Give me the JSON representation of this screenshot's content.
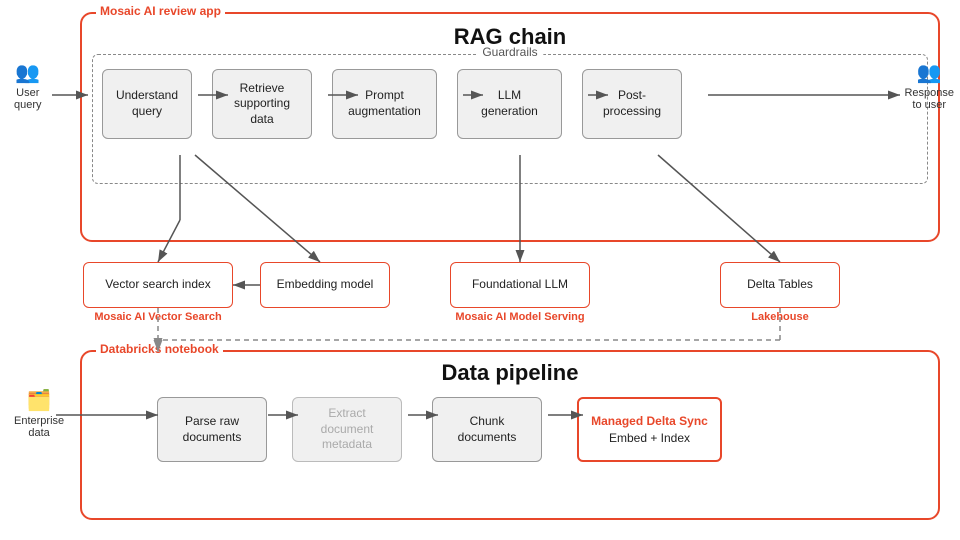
{
  "rag": {
    "outer_label": "Mosaic AI review app",
    "title": "RAG chain",
    "guardrails": "Guardrails",
    "steps": [
      {
        "id": "understand",
        "label": "Understand\nquery"
      },
      {
        "id": "retrieve",
        "label": "Retrieve\nsupporting\ndata"
      },
      {
        "id": "prompt",
        "label": "Prompt\naugmentation"
      },
      {
        "id": "llm",
        "label": "LLM\ngeneration"
      },
      {
        "id": "post",
        "label": "Post-\nprocessing"
      }
    ],
    "user_query": "User\nquery",
    "response": "Response\nto user",
    "bottom_boxes": [
      {
        "id": "vector",
        "label": "Vector search index",
        "sublabel": "Mosaic AI Vector Search"
      },
      {
        "id": "embedding",
        "label": "Embedding model",
        "sublabel": ""
      },
      {
        "id": "foundational",
        "label": "Foundational LLM",
        "sublabel": "Mosaic AI Model Serving"
      },
      {
        "id": "delta",
        "label": "Delta Tables",
        "sublabel": "Lakehouse"
      }
    ]
  },
  "pipeline": {
    "outer_label": "Databricks notebook",
    "title": "Data pipeline",
    "enterprise_label": "Enterprise\ndata",
    "steps": [
      {
        "id": "parse",
        "label": "Parse raw\ndocuments",
        "dim": false
      },
      {
        "id": "extract",
        "label": "Extract\ndocument\nmetadata",
        "dim": true
      },
      {
        "id": "chunk",
        "label": "Chunk\ndocuments",
        "dim": false
      },
      {
        "id": "managed",
        "label_top": "Managed Delta Sync",
        "label_bottom": "Embed + Index",
        "special": true
      }
    ]
  }
}
